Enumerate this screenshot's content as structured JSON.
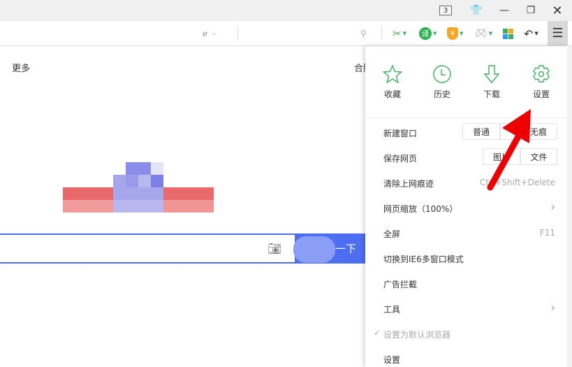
{
  "titlebar": {
    "tab_count": "3",
    "icons": [
      "skin-icon",
      "minimize-icon",
      "restore-icon",
      "close-icon"
    ]
  },
  "toolbar": {
    "icons": [
      "ie-compat-icon",
      "search-icon",
      "screenshot-scissors-icon",
      "translate-icon",
      "payment-shield-icon",
      "game-icon",
      "apps-grid-icon",
      "undo-icon",
      "menu-icon"
    ],
    "translate_label": "译",
    "payment_label": "¥"
  },
  "page": {
    "more": "更多",
    "hz": "合肥",
    "search_button": "一下"
  },
  "menu": {
    "quick": [
      {
        "label": "收藏",
        "icon": "star-icon"
      },
      {
        "label": "历史",
        "icon": "clock-icon"
      },
      {
        "label": "下载",
        "icon": "download-icon"
      },
      {
        "label": "设置",
        "icon": "gear-icon"
      }
    ],
    "new_window": {
      "label": "新建窗口",
      "normal": "普通",
      "incognito": "无痕"
    },
    "save_page": {
      "label": "保存网页",
      "image": "图片",
      "file": "文件"
    },
    "clear": {
      "label": "清除上网痕迹",
      "shortcut": "Ctrl+Shift+Delete"
    },
    "zoom": {
      "label": "网页缩放（100%）"
    },
    "fullscreen": {
      "label": "全屏",
      "shortcut": "F11"
    },
    "ie6": {
      "label": "切换到IE6多窗口模式"
    },
    "adblock": {
      "label": "广告拦截"
    },
    "tools": {
      "label": "工具"
    },
    "default_browser": {
      "label": "设置为默认浏览器"
    },
    "settings": {
      "label": "设置"
    }
  },
  "colors": {
    "accent": "#3bb05a",
    "search_blue": "#4e6ef2",
    "arrow": "#ee0000"
  }
}
